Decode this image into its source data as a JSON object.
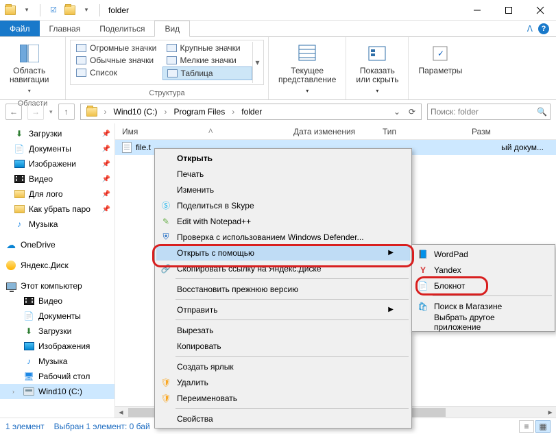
{
  "title": "folder",
  "tabs": {
    "file": "Файл",
    "home": "Главная",
    "share": "Поделиться",
    "view": "Вид"
  },
  "ribbon": {
    "nav_pane": "Область\nнавигации",
    "group_panes": "Области",
    "layouts": {
      "huge": "Огромные значки",
      "large": "Крупные значки",
      "medium": "Обычные значки",
      "small": "Мелкие значки",
      "list": "Список",
      "details": "Таблица"
    },
    "group_layout": "Структура",
    "current_view": "Текущее\nпредставление",
    "show_hide": "Показать\nили скрыть",
    "options": "Параметры"
  },
  "breadcrumbs": [
    "Wind10 (C:)",
    "Program Files",
    "folder"
  ],
  "search_placeholder": "Поиск: folder",
  "columns": {
    "name": "Имя",
    "date": "Дата изменения",
    "type": "Тип",
    "size": "Разм"
  },
  "file": {
    "name": "file.t",
    "type_frag": "ый докум..."
  },
  "sidebar": {
    "quick": [
      "Загрузки",
      "Документы",
      "Изображени",
      "Видео",
      "Для лого",
      "Как убрать паро",
      "Музыка"
    ],
    "onedrive": "OneDrive",
    "yadisk": "Яндекс.Диск",
    "thispc": "Этот компьютер",
    "pc_items": [
      "Видео",
      "Документы",
      "Загрузки",
      "Изображения",
      "Музыка",
      "Рабочий стол",
      "Wind10 (C:)"
    ]
  },
  "ctx": {
    "open": "Открыть",
    "print": "Печать",
    "edit": "Изменить",
    "skype": "Поделиться в Skype",
    "npp": "Edit with Notepad++",
    "defender": "Проверка с использованием Windows Defender...",
    "openwith": "Открыть с помощью",
    "yacopy": "Скопировать ссылку на Яндекс.Диске",
    "restore": "Восстановить прежнюю версию",
    "sendto": "Отправить",
    "cut": "Вырезать",
    "copy": "Копировать",
    "shortcut": "Создать ярлык",
    "delete": "Удалить",
    "rename": "Переименовать",
    "props": "Свойства"
  },
  "sub": {
    "wordpad": "WordPad",
    "yandex": "Yandex",
    "notepad": "Блокнот",
    "store": "Поиск в Магазине",
    "choose": "Выбрать другое приложение"
  },
  "status": {
    "count": "1 элемент",
    "sel": "Выбран 1 элемент: 0 бай"
  }
}
